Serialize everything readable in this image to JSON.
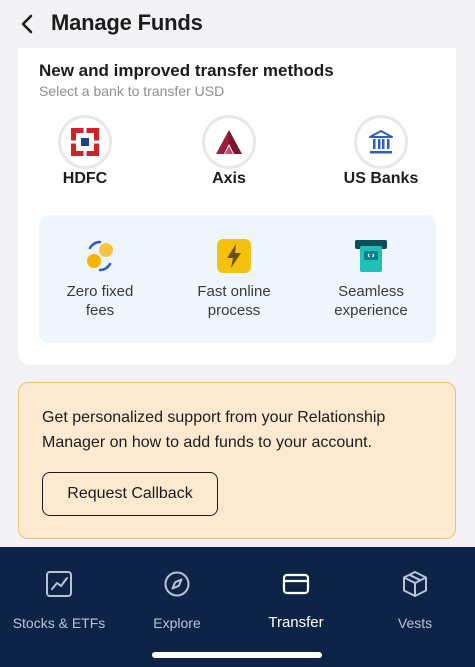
{
  "header": {
    "title": "Manage Funds",
    "back_icon": "chevron-left-icon"
  },
  "transfer_card": {
    "title": "New and improved transfer methods",
    "subtitle": "Select a bank to transfer USD",
    "banks": [
      {
        "label": "HDFC",
        "icon": "hdfc-logo-icon",
        "color": "#d4202a"
      },
      {
        "label": "Axis",
        "icon": "axis-logo-icon",
        "color": "#9b1d3b"
      },
      {
        "label": "US Banks",
        "icon": "bank-building-icon",
        "color": "#2e5cc7"
      }
    ],
    "features": [
      {
        "label_line1": "Zero fixed",
        "label_line2": "fees",
        "icon": "zero-fees-icon"
      },
      {
        "label_line1": "Fast online",
        "label_line2": "process",
        "icon": "lightning-icon"
      },
      {
        "label_line1": "Seamless",
        "label_line2": "experience",
        "icon": "atm-card-icon"
      }
    ]
  },
  "support": {
    "text_line1": "Get personalized support from your Relationship",
    "text_line2": "Manager on how to add funds to your account.",
    "button_label": "Request Callback"
  },
  "bottom_nav": {
    "active": "Transfer",
    "items": [
      {
        "label": "Stocks & ETFs",
        "icon": "chart-icon"
      },
      {
        "label": "Explore",
        "icon": "compass-icon"
      },
      {
        "label": "Transfer",
        "icon": "card-icon"
      },
      {
        "label": "Vests",
        "icon": "box-icon"
      }
    ]
  },
  "colors": {
    "nav_background": "#0e2447",
    "support_background": "#fde9cf",
    "features_background": "#eef5fd"
  }
}
